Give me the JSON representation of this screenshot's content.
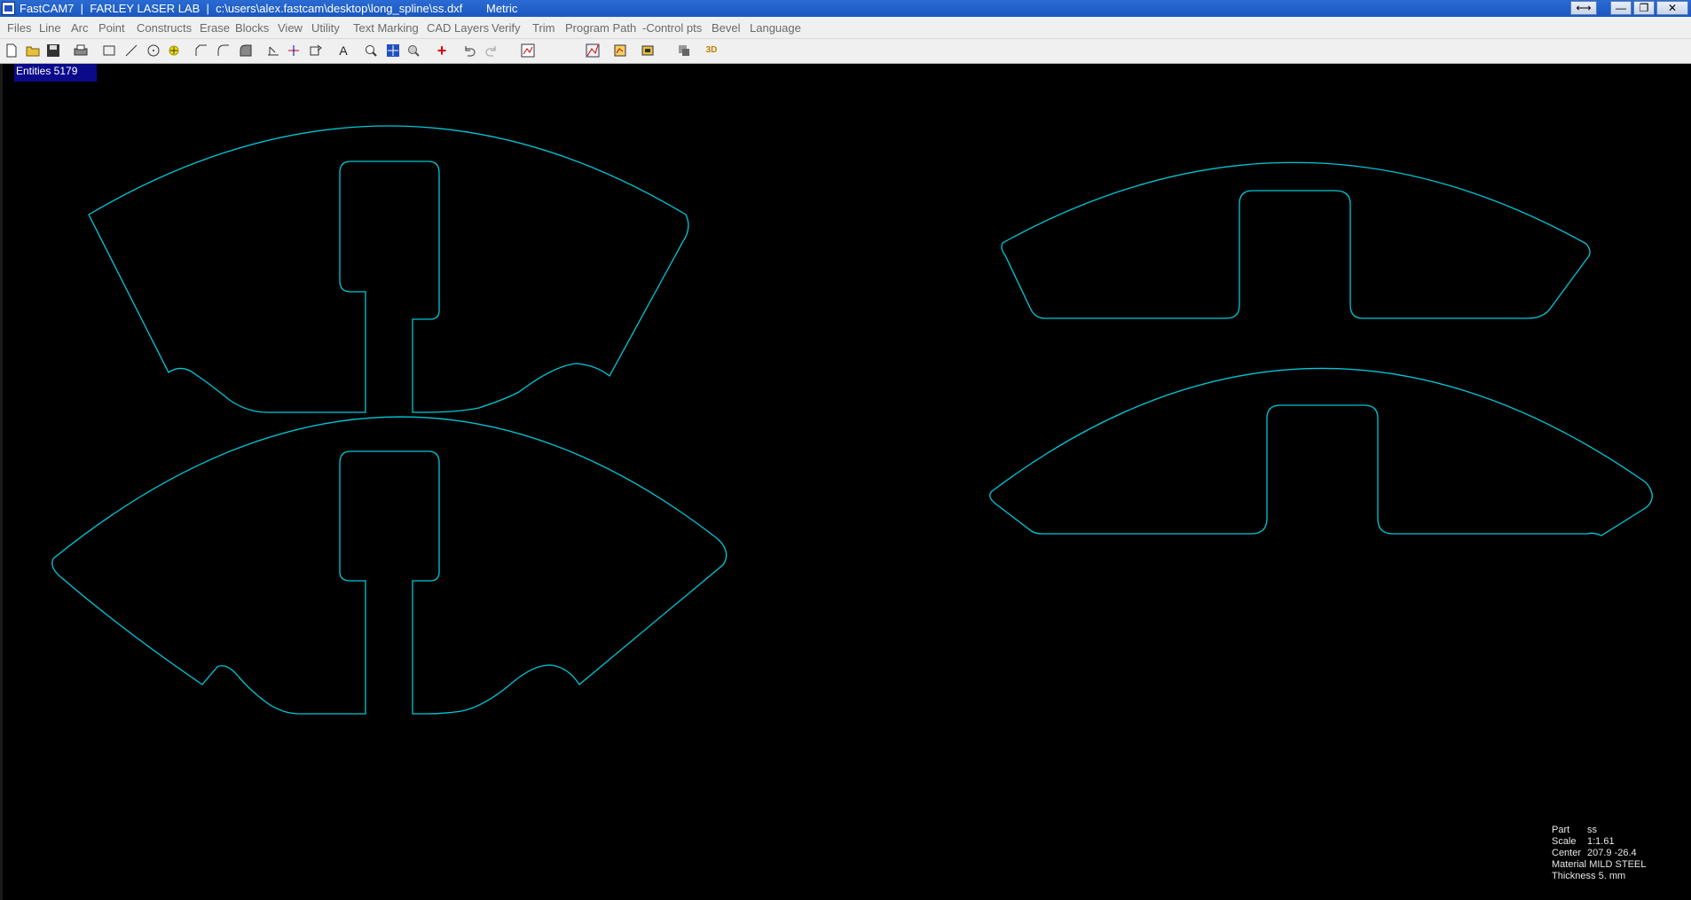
{
  "window": {
    "title": "FastCAM7  |  FARLEY LASER LAB  |  c:\\users\\alex.fastcam\\desktop\\long_spline\\ss.dxf",
    "units": "Metric",
    "resize_label": "⟷",
    "minimize_label": "—",
    "maximize_label": "❐",
    "close_label": "✕"
  },
  "menu": [
    "Files",
    "Line",
    "Arc",
    "Point",
    "Constructs",
    "Erase",
    "Blocks",
    "View",
    "Utility",
    "Text Marking",
    "CAD Layers",
    "Verify",
    "Trim",
    "Program Path",
    "-Control pts",
    "Bevel",
    "Language"
  ],
  "toolbar": {
    "text_tool_label": "A",
    "center_tool_label": "+",
    "three_d_label": "3D"
  },
  "canvas": {
    "background": "#000000",
    "geometry_color": "#00c8d8",
    "entities_label": "Entities 5179"
  },
  "info": {
    "part_key": "Part",
    "part_val": "ss",
    "scale_key": "Scale",
    "scale_val": "1:1.61",
    "center_key": "Center",
    "center_val": "207.9 -26.4",
    "material_key": "Material",
    "material_val": "MILD STEEL",
    "thickness_key": "Thickness",
    "thickness_val": "5. mm"
  }
}
